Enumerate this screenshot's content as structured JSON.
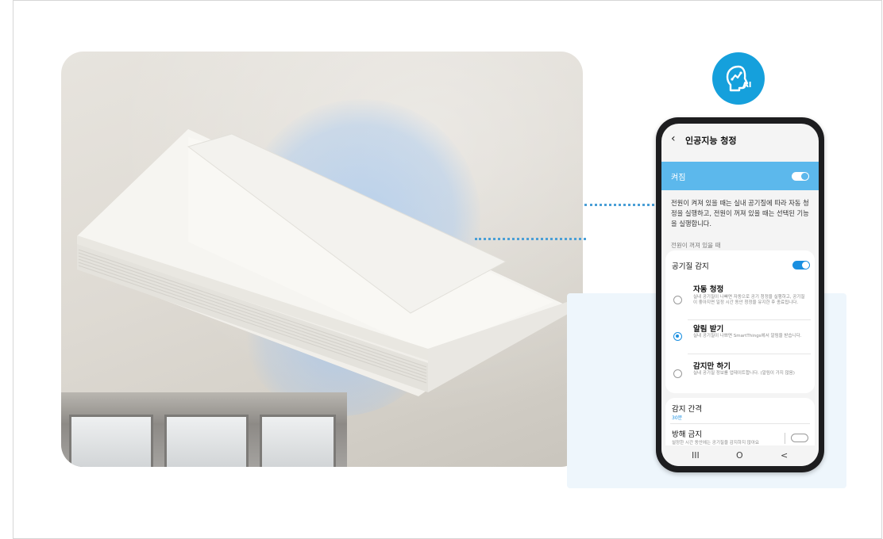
{
  "phone": {
    "title": "인공지능 청정",
    "power_label": "켜짐",
    "power_on": true,
    "description": "전원이 켜져 있을 때는 실내 공기질에 따라 자동 청정을 실행하고, 전원이 꺼져 있을 때는 선택된 기능을 실행합니다.",
    "section_label": "전원이 꺼져 있을 때",
    "air_detect_label": "공기질 감지",
    "air_detect_on": true,
    "options": [
      {
        "title": "자동 청정",
        "desc": "실내 공기질이 나빠면 자동으로 공기 청정을 실행하고, 공기질이 좋아지면 일정 시간 동안 청정을 유지한 후 종료됩니다.",
        "selected": false
      },
      {
        "title": "알림 받기",
        "desc": "실내 공기질이 나쁘면 SmartThings에서 알림을 받습니다.",
        "selected": true
      },
      {
        "title": "감지만 하기",
        "desc": "실내 공기질 정보를 업데이트합니다. (알림이 가지 않음)",
        "selected": false
      }
    ],
    "interval_label": "감지 간격",
    "interval_value": "30분",
    "dnd_label": "방해 금지",
    "dnd_desc": "설정한 시간 동안에는 공기질을 감지하지 않아요",
    "nav": {
      "recents": "III",
      "home": "O",
      "back": "<"
    }
  },
  "badge": {
    "text": "AI",
    "icon": "ai-head-icon"
  },
  "colors": {
    "accent": "#15a0dc",
    "toggle_bar": "#5cb8ec",
    "dots": "#4a9fd6"
  }
}
